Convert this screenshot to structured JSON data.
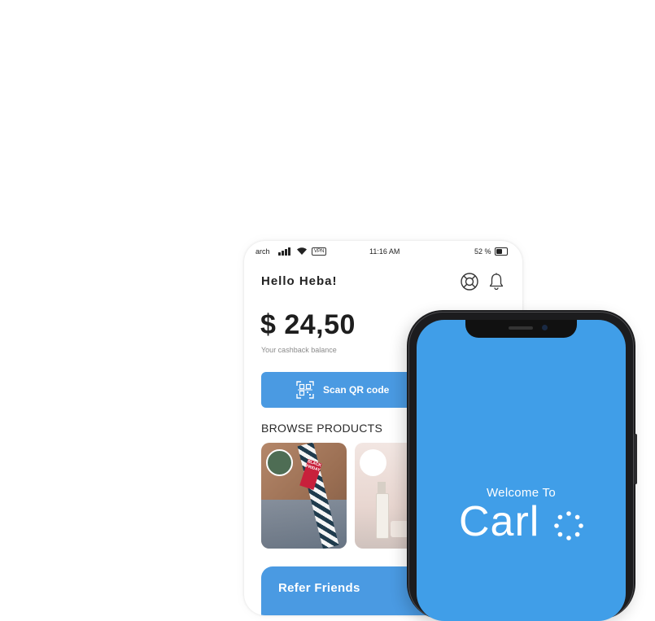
{
  "status_bar": {
    "carrier": "arch",
    "vpn": "VPN",
    "time": "11:16 AM",
    "battery": "52 %"
  },
  "dashboard": {
    "greeting": "Hello Heba!",
    "balance": "$ 24,50",
    "balance_caption": "Your cashback balance",
    "scan_button_label": "Scan QR code",
    "browse_title": "BROWSE PRODUCTS",
    "products": [
      {
        "sale_tag": "BLACK FRIDAY"
      },
      {
        "sale_tag": ""
      }
    ],
    "refer_label": "Refer Friends"
  },
  "splash": {
    "welcome_text": "Welcome To",
    "brand_name": "Carl"
  },
  "colors": {
    "primary": "#4a9ae2",
    "splash_background": "#409ee8",
    "text_dark": "#222222"
  },
  "icons": {
    "help": "lifebuoy-icon",
    "notifications": "bell-icon",
    "scan": "qr-code-icon"
  }
}
